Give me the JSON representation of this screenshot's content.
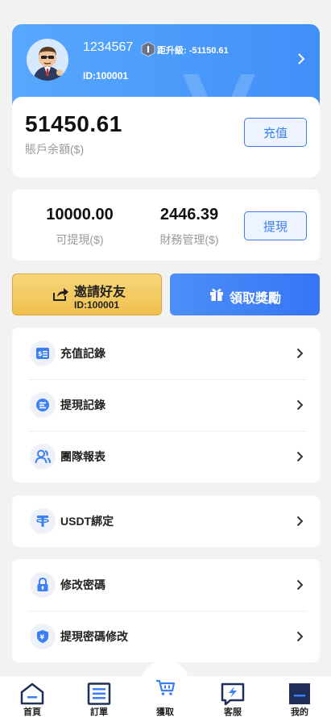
{
  "profile": {
    "username": "1234567",
    "upgrade_text": "距升級: -51150.61",
    "user_id": "ID:100001",
    "balance": "51450.61",
    "balance_label": "賬戶余額($)",
    "recharge_label": "充值"
  },
  "stats": {
    "withdrawable": "10000.00",
    "withdrawable_label": "可提現($)",
    "finance": "2446.39",
    "finance_label": "財務管理($)",
    "withdraw_label": "提現"
  },
  "actions": {
    "invite_label": "邀請好友",
    "invite_id": "ID:100001",
    "reward_label": "領取獎勵"
  },
  "menu": {
    "records": [
      {
        "label": "充值記錄",
        "icon": "recharge-record-icon"
      },
      {
        "label": "提現記錄",
        "icon": "withdraw-record-icon"
      },
      {
        "label": "團隊報表",
        "icon": "team-report-icon"
      }
    ],
    "usdt": {
      "label": "USDT綁定",
      "icon": "usdt-icon"
    },
    "security": [
      {
        "label": "修改密碼",
        "icon": "lock-icon"
      },
      {
        "label": "提現密碼修改",
        "icon": "shield-yen-icon"
      }
    ]
  },
  "tabbar": {
    "home": "首頁",
    "orders": "訂單",
    "grab": "獲取",
    "service": "客服",
    "mine": "我的"
  },
  "colors": {
    "accent": "#3b7ff5",
    "gold": "#f0c04e",
    "header_gradient_start": "#58a8ff",
    "header_gradient_end": "#3f8ff8"
  }
}
